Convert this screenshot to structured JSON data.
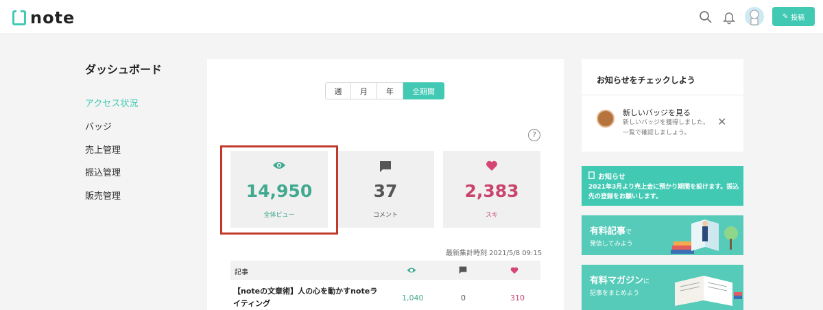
{
  "header": {
    "logo_text": "note",
    "post_label": "投稿",
    "accent": "#41c9b4"
  },
  "sidebar": {
    "title": "ダッシュボード",
    "items": [
      {
        "label": "アクセス状況",
        "active": true
      },
      {
        "label": "バッジ"
      },
      {
        "label": "売上管理"
      },
      {
        "label": "振込管理"
      },
      {
        "label": "販売管理"
      }
    ]
  },
  "period": {
    "options": [
      "週",
      "月",
      "年",
      "全期間"
    ],
    "selected": "全期間"
  },
  "help_label": "?",
  "stats": [
    {
      "icon": "eye-icon",
      "value": "14,950",
      "label": "全体ビュー",
      "color": "#41a98f"
    },
    {
      "icon": "comment-icon",
      "value": "37",
      "label": "コメント",
      "color": "#555555"
    },
    {
      "icon": "heart-icon",
      "value": "2,383",
      "label": "スキ",
      "color": "#c9436d"
    }
  ],
  "updated": "最新集計時刻 2021/5/8 09:15",
  "table": {
    "header_label": "記事",
    "rows": [
      {
        "title": "【noteの文章術】人の心を動かすnoteライティング",
        "views": "1,040",
        "comments": "0",
        "likes": "310"
      }
    ]
  },
  "notice": {
    "title": "お知らせをチェックしよう",
    "badge_title": "新しいバッジを見る",
    "badge_desc": "新しいバッジを獲得しました。一覧で確認しましょう。",
    "close": "✕"
  },
  "info": {
    "title": "お知らせ",
    "body": "2021年3月より売上金に預かり期間を設けます。振込先の登録をお願いします。"
  },
  "promos": [
    {
      "title_main": "有料記事",
      "title_suffix": "で",
      "subtitle": "発信してみよう"
    },
    {
      "title_main": "有料マガジン",
      "title_suffix": "に",
      "subtitle": "記事をまとめよう"
    }
  ]
}
